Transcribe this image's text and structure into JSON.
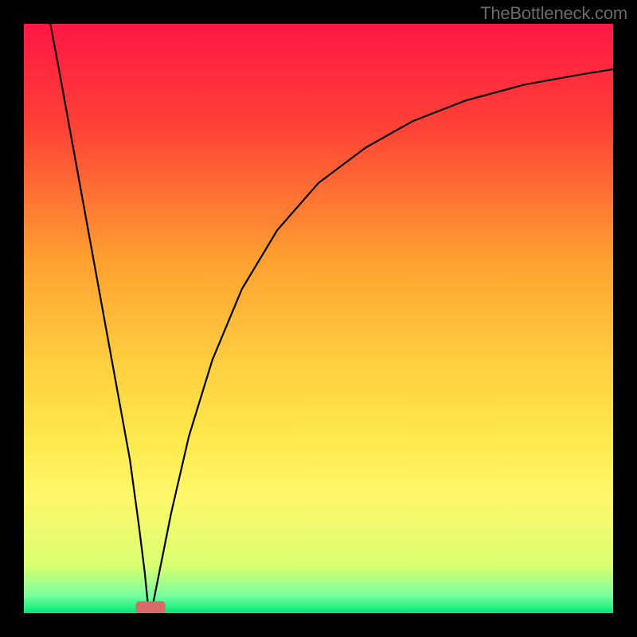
{
  "watermark": "TheBottleneck.com",
  "chart_data": {
    "type": "line",
    "title": "",
    "xlabel": "",
    "ylabel": "",
    "xlim": [
      0,
      100
    ],
    "ylim": [
      0,
      100
    ],
    "grid": false,
    "background_gradient": {
      "stops": [
        {
          "offset": 0,
          "color": "#ff1744"
        },
        {
          "offset": 18,
          "color": "#ff4336"
        },
        {
          "offset": 40,
          "color": "#ffa030"
        },
        {
          "offset": 58,
          "color": "#ffd040"
        },
        {
          "offset": 70,
          "color": "#ffe84a"
        },
        {
          "offset": 80,
          "color": "#fff76a"
        },
        {
          "offset": 92,
          "color": "#d8ff70"
        },
        {
          "offset": 97,
          "color": "#7affa0"
        },
        {
          "offset": 100,
          "color": "#00e676"
        }
      ]
    },
    "marker": {
      "x": 21.5,
      "y": 1.0,
      "width": 5,
      "height": 2,
      "color": "#d86a6a"
    },
    "series": [
      {
        "name": "curve",
        "color": "#000000",
        "points": [
          {
            "x": 4.5,
            "y": 100
          },
          {
            "x": 6,
            "y": 92
          },
          {
            "x": 8,
            "y": 81
          },
          {
            "x": 10,
            "y": 70
          },
          {
            "x": 12,
            "y": 59
          },
          {
            "x": 14,
            "y": 48
          },
          {
            "x": 16,
            "y": 37
          },
          {
            "x": 18,
            "y": 26
          },
          {
            "x": 19.5,
            "y": 15
          },
          {
            "x": 20.5,
            "y": 7
          },
          {
            "x": 21,
            "y": 2
          },
          {
            "x": 21.5,
            "y": 0.5
          },
          {
            "x": 22,
            "y": 2
          },
          {
            "x": 23,
            "y": 7
          },
          {
            "x": 25,
            "y": 17
          },
          {
            "x": 28,
            "y": 30
          },
          {
            "x": 32,
            "y": 43
          },
          {
            "x": 37,
            "y": 55
          },
          {
            "x": 43,
            "y": 65
          },
          {
            "x": 50,
            "y": 73
          },
          {
            "x": 58,
            "y": 79
          },
          {
            "x": 66,
            "y": 83.5
          },
          {
            "x": 75,
            "y": 87
          },
          {
            "x": 85,
            "y": 89.7
          },
          {
            "x": 95,
            "y": 91.5
          },
          {
            "x": 100,
            "y": 92.3
          }
        ]
      }
    ]
  }
}
